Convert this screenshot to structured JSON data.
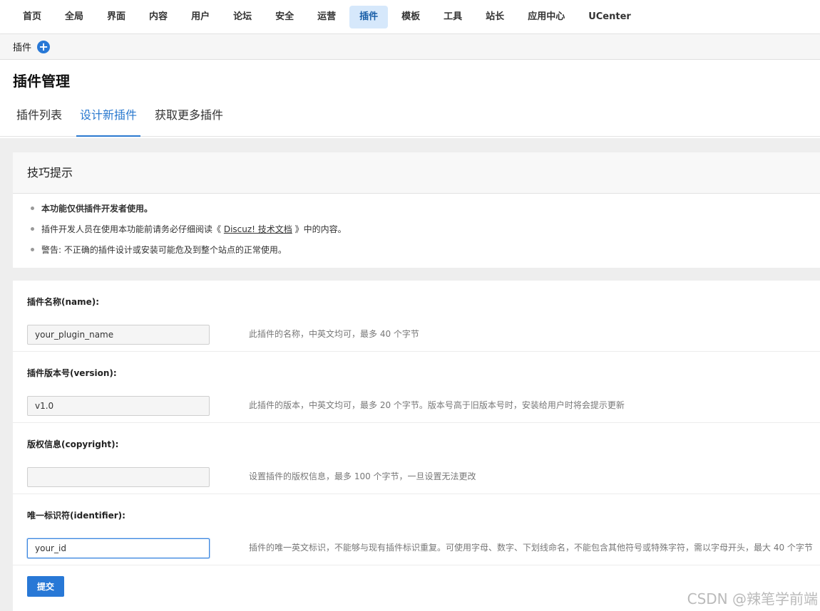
{
  "topnav": {
    "items": [
      {
        "label": "首页"
      },
      {
        "label": "全局"
      },
      {
        "label": "界面"
      },
      {
        "label": "内容"
      },
      {
        "label": "用户"
      },
      {
        "label": "论坛"
      },
      {
        "label": "安全"
      },
      {
        "label": "运营"
      },
      {
        "label": "插件",
        "active": true
      },
      {
        "label": "模板"
      },
      {
        "label": "工具"
      },
      {
        "label": "站长"
      },
      {
        "label": "应用中心"
      },
      {
        "label": "UCenter"
      }
    ]
  },
  "subbar": {
    "label": "插件",
    "add_icon": "plus-circle-icon"
  },
  "page": {
    "title": "插件管理",
    "tabs": [
      {
        "label": "插件列表"
      },
      {
        "label": "设计新插件",
        "active": true
      },
      {
        "label": "获取更多插件"
      }
    ]
  },
  "tips": {
    "title": "技巧提示",
    "items": [
      "本功能仅供插件开发者使用。",
      "插件开发人员在使用本功能前请务必仔细阅读《",
      "警告: 不正确的插件设计或安装可能危及到整个站点的正常使用。"
    ],
    "doc_link": "Discuz! 技术文档",
    "doc_suffix": "》中的内容。"
  },
  "form": {
    "fields": [
      {
        "label": "插件名称(name):",
        "value": "your_plugin_name",
        "hint": "此插件的名称，中英文均可，最多 40 个字节"
      },
      {
        "label": "插件版本号(version):",
        "value": "v1.0",
        "hint": "此插件的版本，中英文均可，最多 20 个字节。版本号高于旧版本号时，安装给用户时将会提示更新"
      },
      {
        "label": "版权信息(copyright):",
        "value": "",
        "hint": "设置插件的版权信息，最多 100 个字节，一旦设置无法更改"
      },
      {
        "label": "唯一标识符(identifier):",
        "value": "your_id",
        "hint": "插件的唯一英文标识，不能够与现有插件标识重复。可使用字母、数字、下划线命名，不能包含其他符号或特殊字符，需以字母开头，最大 40 个字节"
      }
    ],
    "submit_label": "提交"
  },
  "watermark": "CSDN @辣笔学前端",
  "colors": {
    "accent": "#2878d6",
    "nav_active_bg": "#d6e8fb",
    "tab_active": "#2a79cf"
  }
}
